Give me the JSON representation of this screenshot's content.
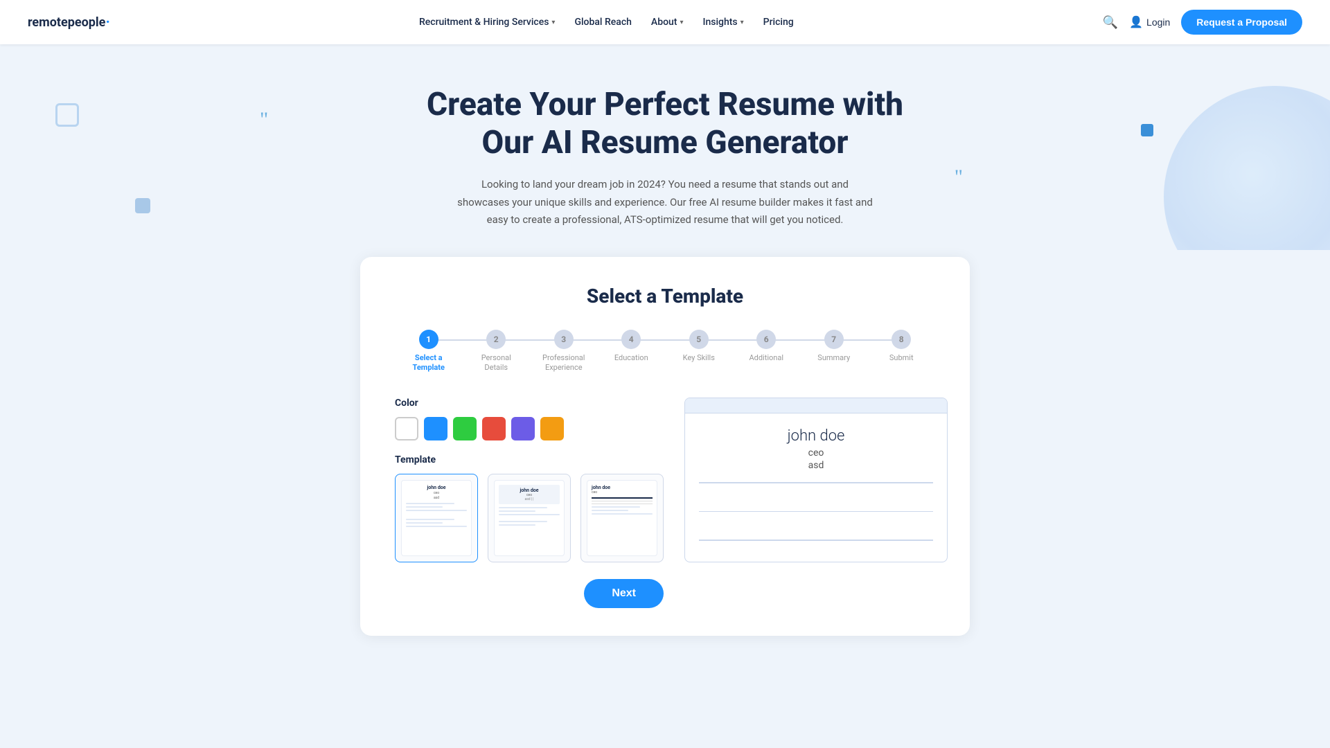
{
  "brand": {
    "name_part1": "remote",
    "name_part2": "people",
    "dot": "·"
  },
  "nav": {
    "links": [
      {
        "label": "Recruitment & Hiring Services",
        "has_dropdown": true
      },
      {
        "label": "Global Reach",
        "has_dropdown": false
      },
      {
        "label": "About",
        "has_dropdown": true
      },
      {
        "label": "Insights",
        "has_dropdown": true
      },
      {
        "label": "Pricing",
        "has_dropdown": false
      }
    ],
    "login_label": "Login",
    "proposal_btn": "Request a Proposal"
  },
  "hero": {
    "title": "Create Your Perfect Resume with Our AI Resume Generator",
    "subtitle": "Looking to land your dream job in 2024? You need a resume that stands out and showcases your unique skills and experience. Our free AI resume builder makes it fast and easy to create a professional, ATS-optimized resume that will get you noticed."
  },
  "card": {
    "title": "Select a Template",
    "steps": [
      {
        "number": "1",
        "label": "Select a\nTemplate",
        "active": true
      },
      {
        "number": "2",
        "label": "Personal\nDetails",
        "active": false
      },
      {
        "number": "3",
        "label": "Professional\nExperience",
        "active": false
      },
      {
        "number": "4",
        "label": "Education",
        "active": false
      },
      {
        "number": "5",
        "label": "Key Skills",
        "active": false
      },
      {
        "number": "6",
        "label": "Additional",
        "active": false
      },
      {
        "number": "7",
        "label": "Summary",
        "active": false
      },
      {
        "number": "8",
        "label": "Submit",
        "active": false
      }
    ],
    "color_label": "Color",
    "colors": [
      {
        "hex": "#ffffff",
        "selected": true
      },
      {
        "hex": "#1e90ff",
        "selected": false
      },
      {
        "hex": "#2ecc40",
        "selected": false
      },
      {
        "hex": "#e74c3c",
        "selected": false
      },
      {
        "hex": "#6c5ce7",
        "selected": false
      },
      {
        "hex": "#f39c12",
        "selected": false
      }
    ],
    "template_label": "Template",
    "templates": [
      {
        "id": "t1",
        "selected": true,
        "style": "classic"
      },
      {
        "id": "t2",
        "selected": false,
        "style": "modern"
      },
      {
        "id": "t3",
        "selected": false,
        "style": "sidebar"
      }
    ],
    "preview": {
      "name": "john doe",
      "role": "ceo",
      "location": "asd"
    },
    "next_btn": "Next"
  }
}
